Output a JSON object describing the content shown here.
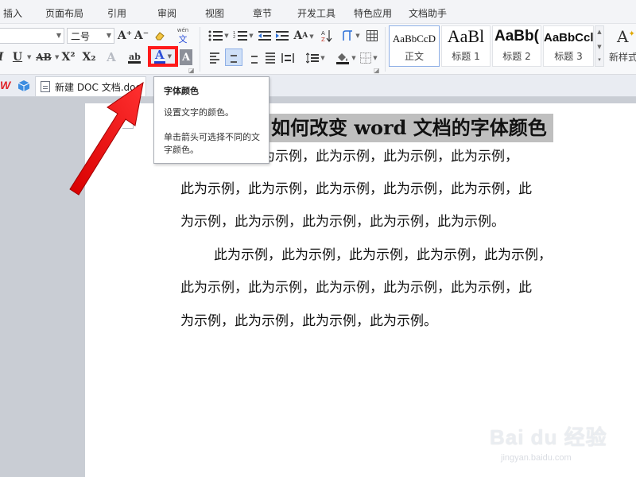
{
  "menu": [
    "插入",
    "页面布局",
    "引用",
    "审阅",
    "视图",
    "章节",
    "开发工具",
    "特色应用",
    "文档助手"
  ],
  "ribbon": {
    "font_size_value": "二号",
    "grow_font": "A⁺",
    "shrink_font": "A⁻",
    "pinyin_top": "wén",
    "pinyin_char": "文",
    "italic": "I",
    "underline": "U",
    "strikethrough": "AB",
    "superscript": "X²",
    "subscript": "X₂",
    "font_color_letter": "A",
    "styles": [
      {
        "preview": "AaBbCcD",
        "name": "正文"
      },
      {
        "preview": "AaBl",
        "name": "标题 1"
      },
      {
        "preview": "AaBb(",
        "name": "标题 2"
      },
      {
        "preview": "AaBbCcl",
        "name": "标题 3"
      }
    ],
    "new_style_label": "新样式"
  },
  "tabs": {
    "document_tab": "新建 DOC 文档.doc"
  },
  "tooltip": {
    "title": "字体颜色",
    "description": "设置文字的颜色。",
    "hint": "单击箭头可选择不同的文字颜色。"
  },
  "document": {
    "title": "如何改变 word 文档的字体颜色",
    "para1_lines": [
      "此为示例，此为示例，此为示例，此为示例，此为示例，",
      "此为示例，此为示例，此为示例，此为示例，此为示例，此",
      "为示例，此为示例，此为示例，此为示例，此为示例。"
    ],
    "para2_lines": [
      "此为示例，此为示例，此为示例，此为示例，此为示例，",
      "此为示例，此为示例，此为示例，此为示例，此为示例，此",
      "为示例，此为示例，此为示例，此为示例。"
    ]
  },
  "watermark": {
    "logo": "Bai du 经验",
    "url": "jingyan.baidu.com"
  },
  "colors": {
    "annotation_red": "#ff1a1a",
    "font_color_blue": "#2b4fd8",
    "title_highlight": "#bfbfbf"
  }
}
